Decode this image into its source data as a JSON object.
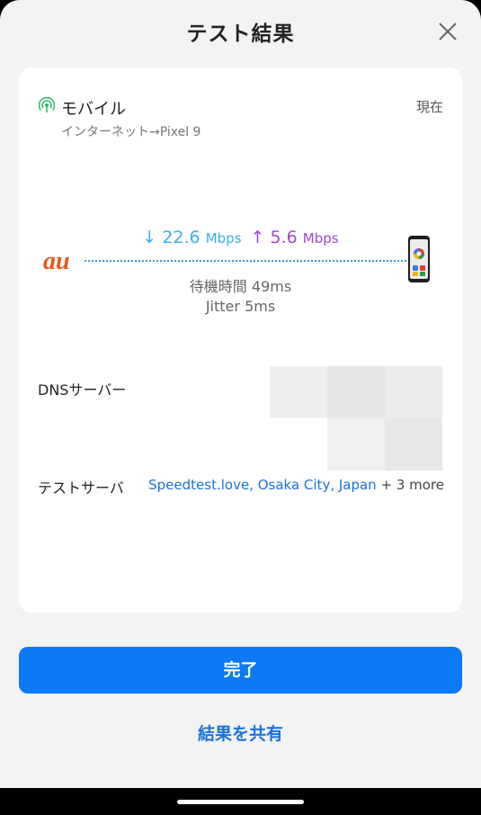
{
  "header": {
    "title": "テスト結果"
  },
  "network": {
    "name": "モバイル",
    "time": "現在",
    "route": "インターネット→Pixel 9"
  },
  "speed": {
    "down_arrow": "↓",
    "download": "22.6",
    "up_arrow": "↑",
    "upload": "5.6",
    "unit": "Mbps",
    "latency_label": "待機時間",
    "latency": "49ms",
    "jitter_label": "Jitter",
    "jitter": "5ms"
  },
  "carrier": {
    "logo_text": "au"
  },
  "dns": {
    "label": "DNSサーバー"
  },
  "server": {
    "label": "テストサーバ",
    "value": "Speedtest.love, Osaka City, Japan",
    "more": "+ 3 more"
  },
  "actions": {
    "done": "完了",
    "share": "結果を共有"
  },
  "colors": {
    "accent": "#0c79f5",
    "download": "#3ab0e6",
    "upload": "#a046d6",
    "carrier": "#e8581c"
  }
}
